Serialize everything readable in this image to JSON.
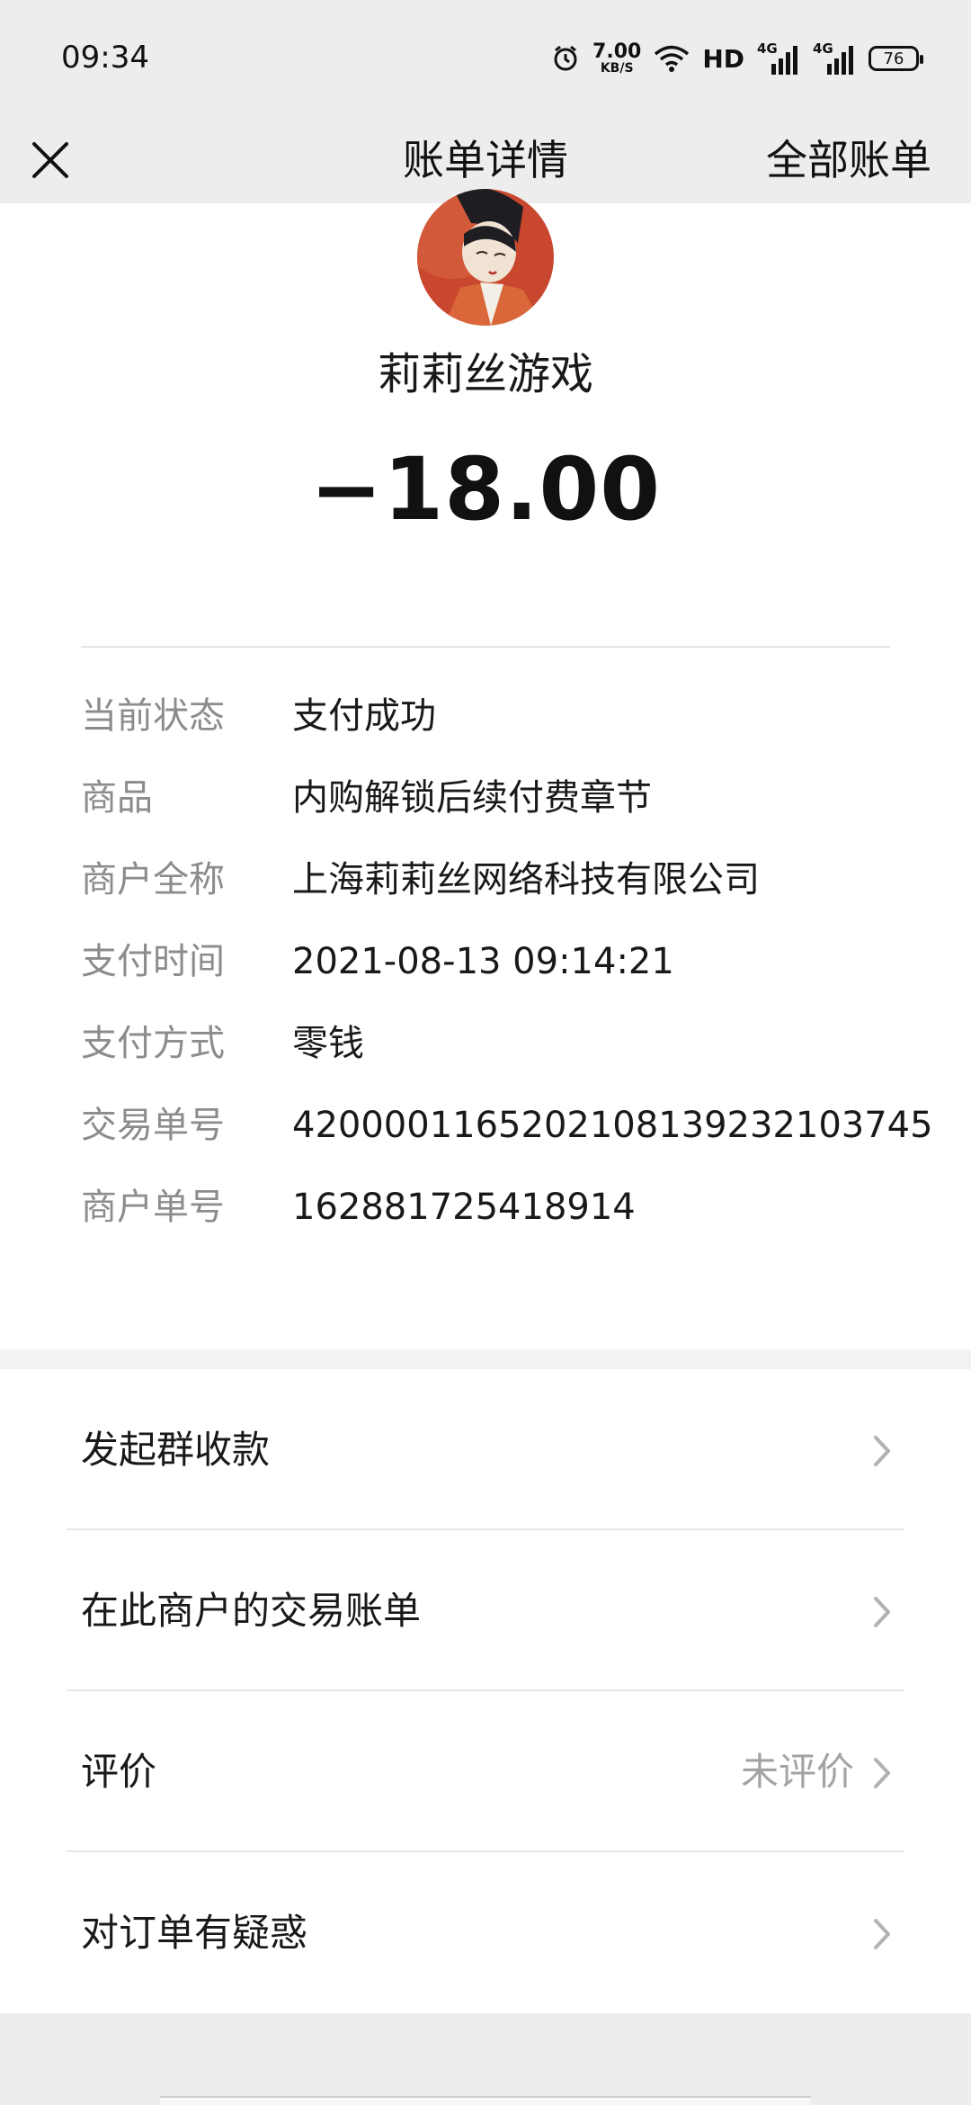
{
  "status_bar": {
    "time": "09:34",
    "speed_value": "7.00",
    "speed_unit": "KB/S",
    "hd": "HD",
    "net1": "4G",
    "net2": "4G",
    "battery": "76"
  },
  "nav": {
    "title": "账单详情",
    "right_link": "全部账单",
    "close_icon": "close-icon"
  },
  "header": {
    "merchant_name": "莉莉丝游戏",
    "amount": "−18.00"
  },
  "details": [
    {
      "key": "当前状态",
      "value": "支付成功"
    },
    {
      "key": "商品",
      "value": "内购解锁后续付费章节"
    },
    {
      "key": "商户全称",
      "value": "上海莉莉丝网络科技有限公司"
    },
    {
      "key": "支付时间",
      "value": "2021-08-13 09:14:21"
    },
    {
      "key": "支付方式",
      "value": "零钱"
    },
    {
      "key": "交易单号",
      "value": "4200001165202108139232103745"
    },
    {
      "key": "商户单号",
      "value": "162881725418914"
    }
  ],
  "menu": [
    {
      "label": "发起群收款",
      "hint": ""
    },
    {
      "label": "在此商户的交易账单",
      "hint": ""
    },
    {
      "label": "评价",
      "hint": "未评价"
    },
    {
      "label": "对订单有疑惑",
      "hint": ""
    }
  ]
}
